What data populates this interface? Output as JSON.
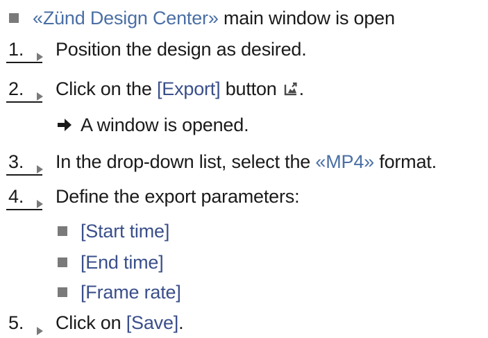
{
  "precondition": {
    "app_name": "«Zünd Design Center»",
    "text": " main window is open"
  },
  "steps": [
    {
      "number": "1.",
      "text": "Position the design as desired."
    },
    {
      "number": "2.",
      "before": "Click on the ",
      "ui": "[Export]",
      "after": " button",
      "icon": "export-icon",
      "end": "."
    },
    {
      "number": "3.",
      "before": "In the drop-down list, select the ",
      "menu": "«MP4»",
      "after": " format."
    },
    {
      "number": "4.",
      "text": "Define the export parameters:"
    },
    {
      "number": "5.",
      "before": "Click on ",
      "ui": "[Save]",
      "after": "."
    }
  ],
  "result": {
    "text": "A window is opened."
  },
  "parameters": [
    "[Start time]",
    "[End time]",
    "[Frame rate]"
  ],
  "colors": {
    "ui_reference": "#3a4f8a",
    "menu_reference": "#4a6fa5",
    "bullet": "#7a7a7a",
    "text": "#1a1a1a"
  }
}
